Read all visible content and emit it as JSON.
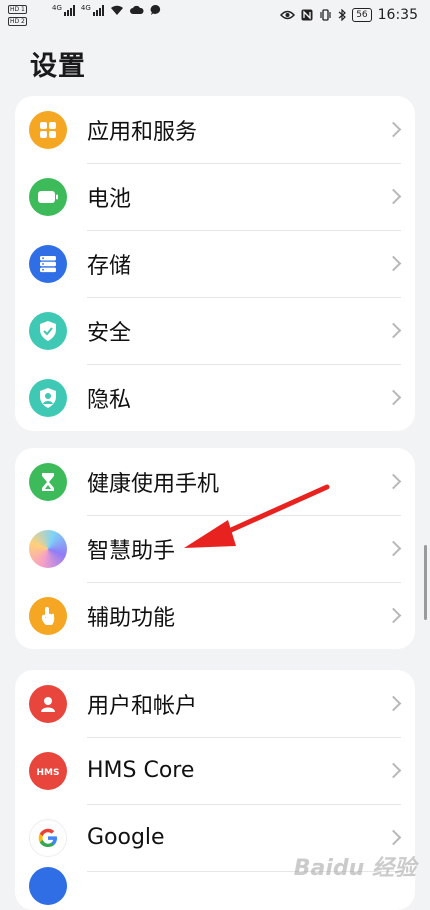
{
  "status_bar": {
    "sim1_label": "HD 1",
    "sim2_label": "HD 2",
    "net1": "4G",
    "net2": "4G",
    "battery": "56",
    "time": "16:35"
  },
  "page": {
    "title": "设置"
  },
  "groups": [
    {
      "items": [
        {
          "label": "应用和服务",
          "icon": "apps-icon",
          "color": "#f5a623"
        },
        {
          "label": "电池",
          "icon": "battery-icon",
          "color": "#3dbb5a"
        },
        {
          "label": "存储",
          "icon": "storage-icon",
          "color": "#2f6ee5"
        },
        {
          "label": "安全",
          "icon": "shield-icon",
          "color": "#3fc9b4"
        },
        {
          "label": "隐私",
          "icon": "privacy-icon",
          "color": "#3fc9b4"
        }
      ]
    },
    {
      "items": [
        {
          "label": "健康使用手机",
          "icon": "hourglass-icon",
          "color": "#3dbb5a"
        },
        {
          "label": "智慧助手",
          "icon": "assistant-icon",
          "color": "#b98ef0"
        },
        {
          "label": "辅助功能",
          "icon": "hand-icon",
          "color": "#f5a623"
        }
      ]
    },
    {
      "items": [
        {
          "label": "用户和帐户",
          "icon": "user-icon",
          "color": "#e8453c"
        },
        {
          "label": "HMS Core",
          "icon": "hms-icon",
          "color": "#e8453c"
        },
        {
          "label": "Google",
          "icon": "google-icon",
          "color": "#ffffff"
        }
      ]
    }
  ],
  "annotation": {
    "arrow_color": "#e8231f"
  },
  "watermark": "Baidu 经验"
}
